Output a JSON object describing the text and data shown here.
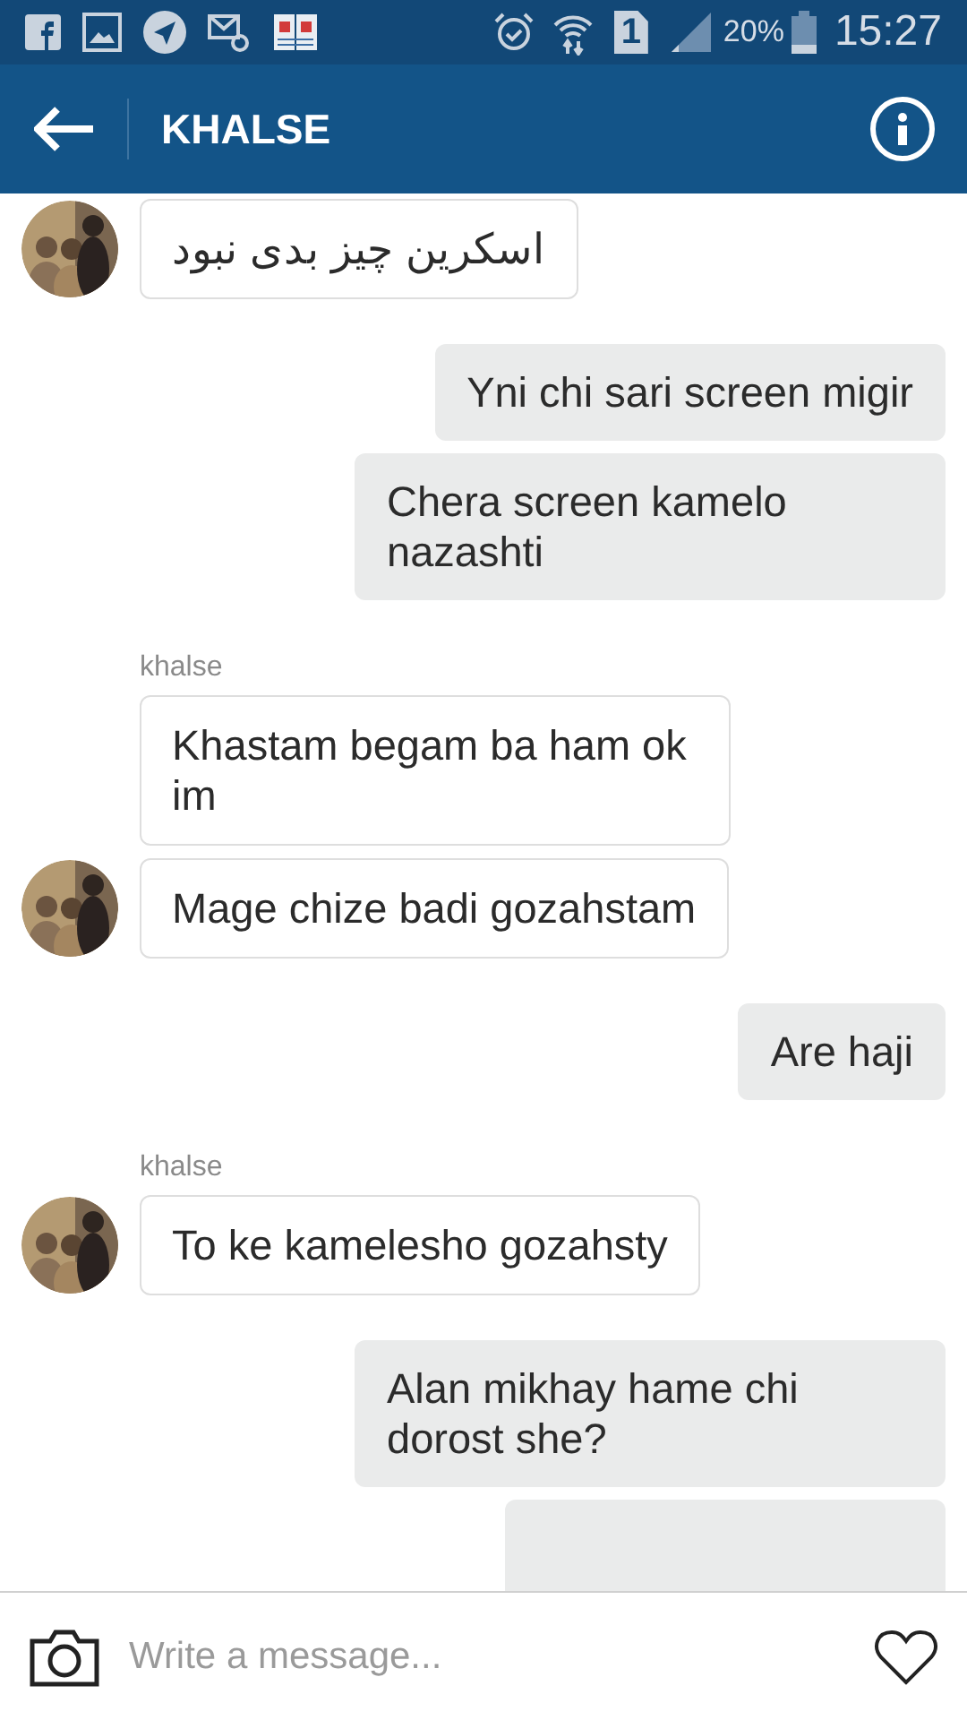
{
  "status_bar": {
    "battery": "20%",
    "time": "15:27",
    "sim": "1"
  },
  "header": {
    "title": "KHALSE"
  },
  "messages": [
    {
      "kind": "incoming",
      "text": "اسکرین  چیز بدی نبود",
      "avatar": true,
      "rtl": true
    },
    {
      "kind": "outgoing",
      "text": "Yni chi sari screen migir"
    },
    {
      "kind": "outgoing",
      "text": "Chera screen kamelo nazashti"
    },
    {
      "kind": "incoming",
      "sender": "khalse",
      "text": "Khastam begam ba ham ok im",
      "avatar": false
    },
    {
      "kind": "incoming",
      "text": "Mage chize badi gozahstam",
      "avatar": true
    },
    {
      "kind": "outgoing",
      "text": "Are haji"
    },
    {
      "kind": "incoming",
      "sender": "khalse",
      "text": "To ke kamelesho gozahsty",
      "avatar": true
    },
    {
      "kind": "outgoing",
      "text": "Alan mikhay hame chi dorost she?"
    },
    {
      "kind": "outgoing_partial"
    }
  ],
  "composer": {
    "placeholder": "Write a message..."
  }
}
